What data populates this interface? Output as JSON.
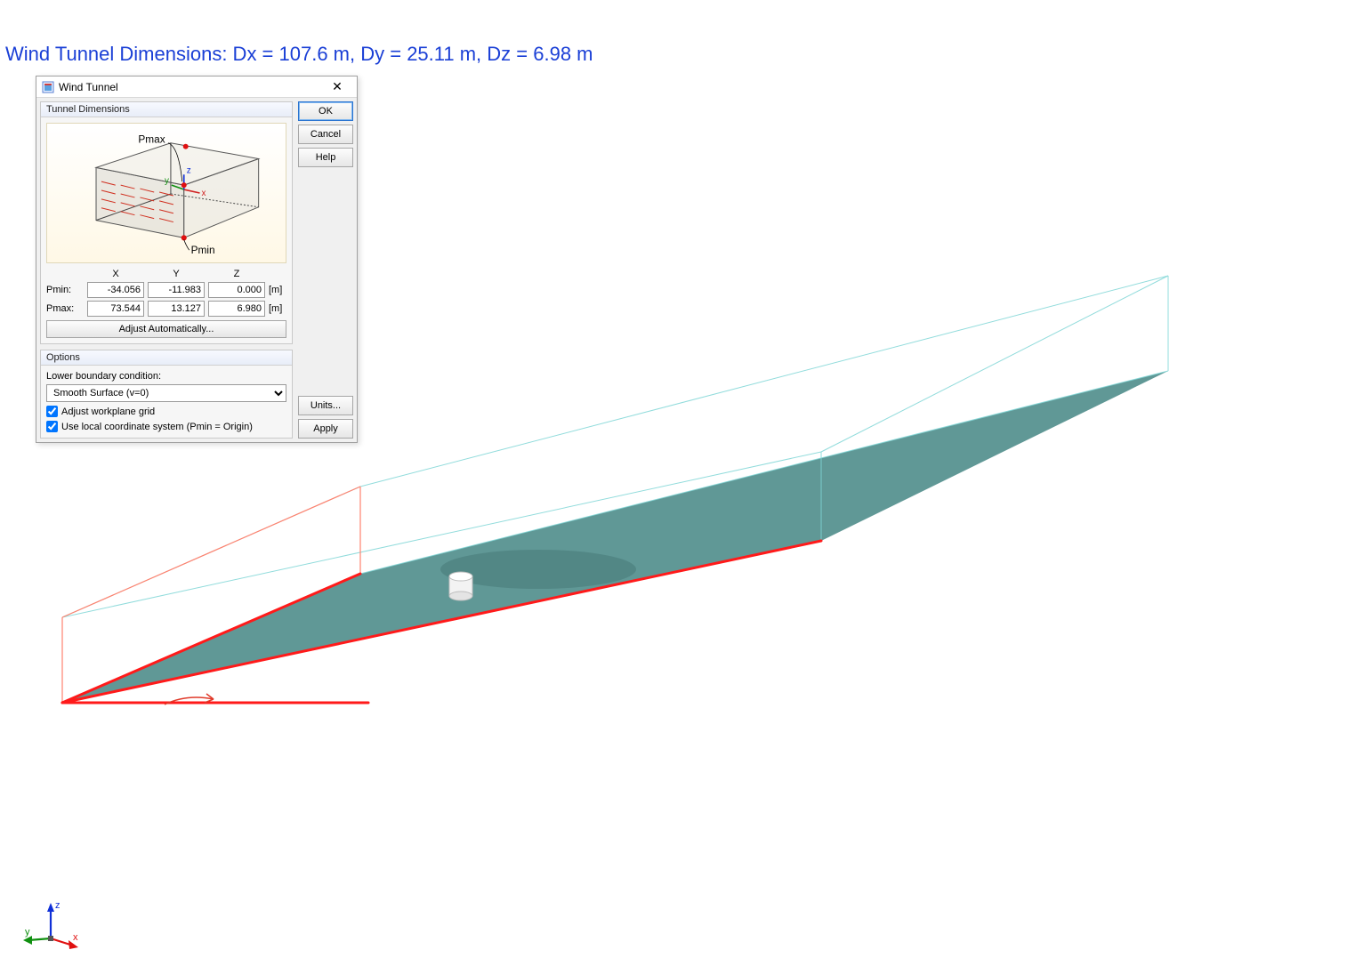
{
  "caption": "Wind Tunnel Dimensions: Dx = 107.6 m, Dy = 25.11 m, Dz = 6.98 m",
  "dialog": {
    "title": "Wind Tunnel",
    "close_glyph": "✕",
    "section_dimensions": "Tunnel Dimensions",
    "diagram": {
      "pmax_label": "Pmax",
      "pmin_label": "Pmin",
      "axis_x": "x",
      "axis_y": "y",
      "axis_z": "z"
    },
    "headers": {
      "x": "X",
      "y": "Y",
      "z": "Z"
    },
    "pmin": {
      "label": "Pmin:",
      "x": "-34.056",
      "y": "-11.983",
      "z": "0.000",
      "unit": "[m]"
    },
    "pmax": {
      "label": "Pmax:",
      "x": "73.544",
      "y": "13.127",
      "z": "6.980",
      "unit": "[m]"
    },
    "adjust_auto": "Adjust Automatically...",
    "section_options": "Options",
    "lower_bc_label": "Lower boundary condition:",
    "lower_bc_value": "Smooth Surface (v=0)",
    "chk_adjust_grid": "Adjust workplane grid",
    "chk_local_coord": "Use local coordinate system (Pmin = Origin)",
    "buttons": {
      "ok": "OK",
      "cancel": "Cancel",
      "help": "Help",
      "units": "Units...",
      "apply": "Apply"
    }
  },
  "axis_labels": {
    "x": "x",
    "y": "y",
    "z": "z"
  },
  "colors": {
    "caption": "#1a3fd6",
    "floor_fill": "#538f8d",
    "box_edge_cyan": "#6cd1d1",
    "box_edge_red": "#ff5a4a",
    "highlight_red": "#ff1a1a"
  }
}
